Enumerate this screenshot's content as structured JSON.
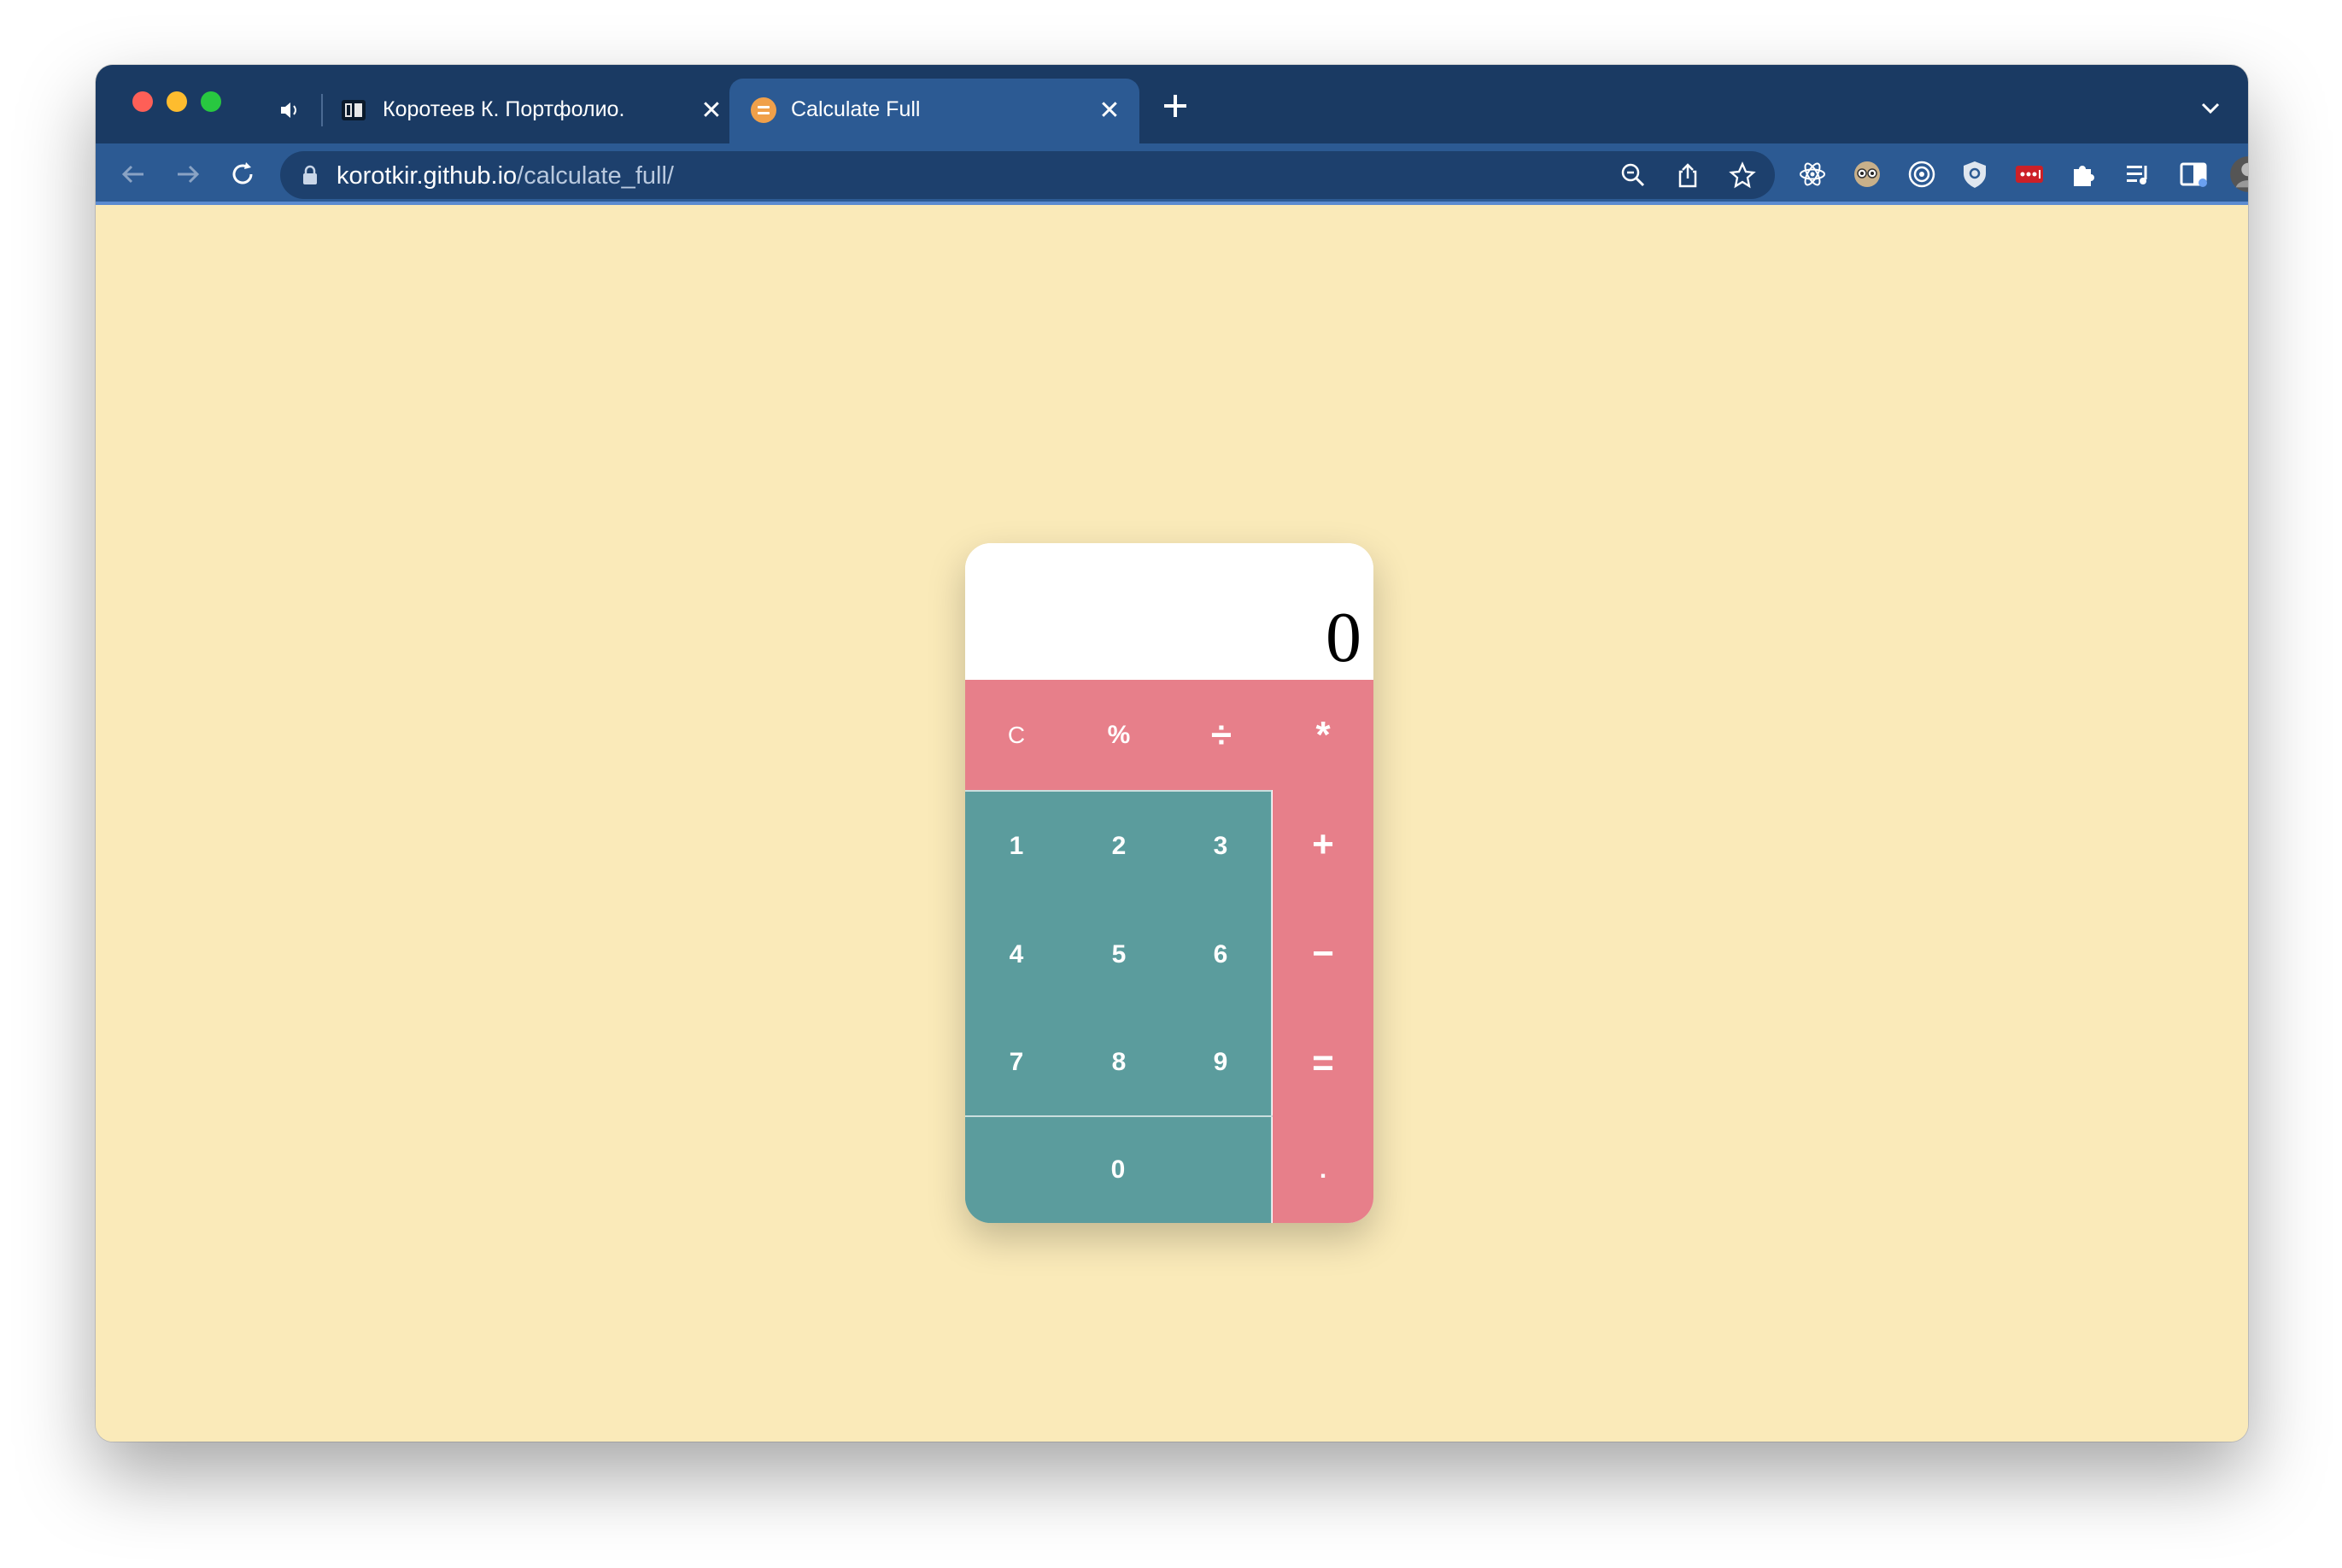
{
  "browser": {
    "tabs": [
      {
        "title": "Коротеев К. Портфолио.",
        "active": false,
        "audio": true
      },
      {
        "title": "Calculate Full",
        "active": true,
        "audio": false
      }
    ],
    "url_host": "korotkir.github.io",
    "url_path": "/calculate_full/",
    "colors": {
      "tabstrip": "#1a3a63",
      "toolbar": "#2c5a93",
      "omnibox": "#1d406d"
    },
    "toolbar_icons": [
      "zoom-out-icon",
      "share-icon",
      "bookmark-star-icon"
    ],
    "extension_icons": [
      "react-devtools-icon",
      "owl-extension-icon",
      "target-extension-icon",
      "shield-extension-icon",
      "lastpass-icon",
      "extensions-puzzle-icon",
      "media-queue-icon",
      "sidepanel-icon",
      "profile-avatar",
      "kebab-menu-icon"
    ]
  },
  "page": {
    "background": "#faeab9"
  },
  "calculator": {
    "display": "0",
    "colors": {
      "operator": "#e77f8a",
      "number": "#5b9c9d",
      "display": "#ffffff"
    },
    "top_row": [
      "C",
      "%",
      "÷",
      "*"
    ],
    "number_rows": [
      [
        "1",
        "2",
        "3"
      ],
      [
        "4",
        "5",
        "6"
      ],
      [
        "7",
        "8",
        "9"
      ]
    ],
    "right_column": [
      "+",
      "−",
      "=",
      "."
    ],
    "zero": "0"
  }
}
